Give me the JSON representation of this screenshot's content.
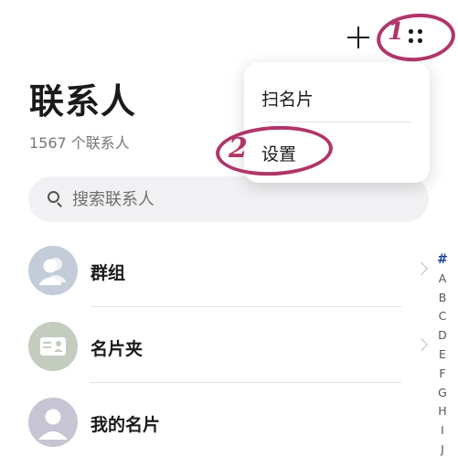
{
  "header": {
    "title": "联系人",
    "count": "1567 个联系人",
    "add_icon": "plus-icon",
    "more_icon": "more-dots-icon"
  },
  "search": {
    "placeholder": "搜索联系人",
    "icon": "search-icon"
  },
  "list": {
    "items": [
      {
        "label": "群组",
        "icon": "group-avatar-icon",
        "has_chevron": true
      },
      {
        "label": "名片夹",
        "icon": "card-holder-icon",
        "has_chevron": true
      },
      {
        "label": "我的名片",
        "icon": "person-avatar-icon",
        "has_chevron": false
      }
    ]
  },
  "alpha_index": [
    "#",
    "A",
    "B",
    "C",
    "D",
    "E",
    "F",
    "G",
    "H",
    "I",
    "J"
  ],
  "alpha_active": "#",
  "menu": {
    "items": [
      {
        "label": "扫名片"
      },
      {
        "label": "设置"
      }
    ]
  },
  "annotations": {
    "step1": "1",
    "step2": "2",
    "color": "#b0356a"
  },
  "colors": {
    "accent": "#1a3fa0",
    "search_bg": "#f1f1f3",
    "annotation": "#b0356a"
  }
}
